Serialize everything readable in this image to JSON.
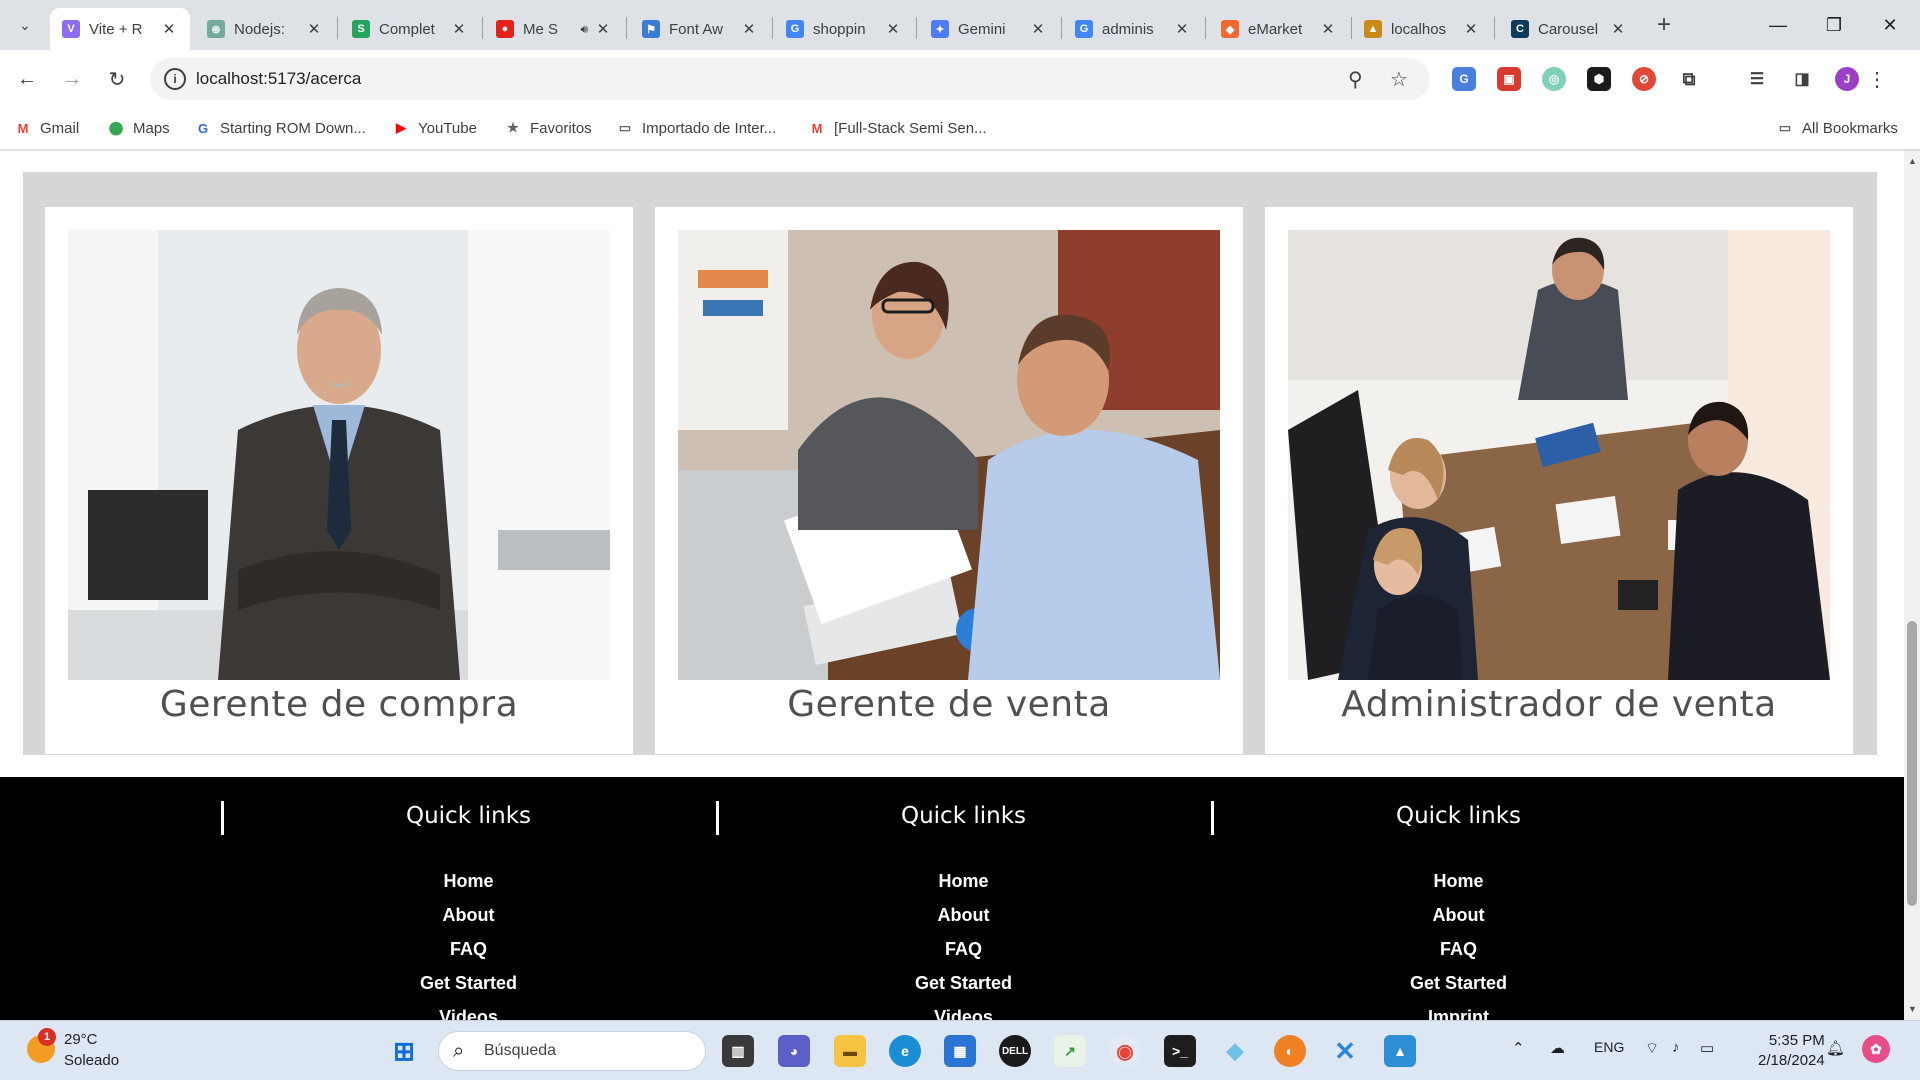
{
  "browser": {
    "tabs": [
      {
        "title": "Vite + R",
        "active": true,
        "favicon_color": "#8e6cf0",
        "favicon_glyph": "V"
      },
      {
        "title": "Nodejs:",
        "active": false,
        "favicon_color": "#74aa9c",
        "favicon_glyph": "⊛"
      },
      {
        "title": "Complet",
        "active": false,
        "favicon_color": "#22a45d",
        "favicon_glyph": "S"
      },
      {
        "title": "Me S",
        "active": false,
        "favicon_color": "#e62117",
        "favicon_glyph": "●"
      },
      {
        "title": "Font Aw",
        "active": false,
        "favicon_color": "#3a7bd5",
        "favicon_glyph": "⚑"
      },
      {
        "title": "shoppin",
        "active": false,
        "favicon_color": "#4285f4",
        "favicon_glyph": "G"
      },
      {
        "title": "Gemini",
        "active": false,
        "favicon_color": "#4c7cf3",
        "favicon_glyph": "✦"
      },
      {
        "title": "adminis",
        "active": false,
        "favicon_color": "#4285f4",
        "favicon_glyph": "G"
      },
      {
        "title": "eMarket",
        "active": false,
        "favicon_color": "#f06a30",
        "favicon_glyph": "◆"
      },
      {
        "title": "localhos",
        "active": false,
        "favicon_color": "#c98a18",
        "favicon_glyph": "▲"
      },
      {
        "title": "Carousel",
        "active": false,
        "favicon_color": "#0d3b5a",
        "favicon_glyph": "C"
      }
    ],
    "address": {
      "url": "localhost:5173/acerca"
    },
    "bookmarks": [
      {
        "label": "Gmail",
        "icon": "gmail-icon",
        "color": "#ea4335",
        "glyph": "M"
      },
      {
        "label": "Maps",
        "icon": "maps-icon",
        "color": "#34a853",
        "glyph": "⬤"
      },
      {
        "label": "Starting ROM Down...",
        "icon": "rom-icon",
        "color": "#3367d6",
        "glyph": "G"
      },
      {
        "label": "YouTube",
        "icon": "youtube-icon",
        "color": "#ff0000",
        "glyph": "▶"
      },
      {
        "label": "Favoritos",
        "icon": "star-icon",
        "color": "#5f6368",
        "glyph": "★"
      },
      {
        "label": "Importado de Inter...",
        "icon": "folder-icon",
        "color": "#5f6368",
        "glyph": "▭"
      },
      {
        "label": "[Full-Stack Semi Sen...",
        "icon": "gmail-icon",
        "color": "#ea4335",
        "glyph": "M"
      }
    ],
    "all_bookmarks_label": "All Bookmarks",
    "profile_initial": "J"
  },
  "page": {
    "cards": [
      {
        "title": "Gerente de compra"
      },
      {
        "title": "Gerente de venta"
      },
      {
        "title": "Administrador de venta"
      }
    ],
    "footer": {
      "columns": [
        {
          "heading": "Quick links",
          "links": [
            "Home",
            "About",
            "FAQ",
            "Get Started",
            "Videos"
          ]
        },
        {
          "heading": "Quick links",
          "links": [
            "Home",
            "About",
            "FAQ",
            "Get Started",
            "Videos"
          ]
        },
        {
          "heading": "Quick links",
          "links": [
            "Home",
            "About",
            "FAQ",
            "Get Started",
            "Imprint"
          ]
        }
      ]
    }
  },
  "taskbar": {
    "weather": {
      "temp": "29°C",
      "desc": "Soleado",
      "badge": "1"
    },
    "search_placeholder": "Búsqueda",
    "language": "ENG",
    "time": "5:35 PM",
    "date": "2/18/2024"
  }
}
